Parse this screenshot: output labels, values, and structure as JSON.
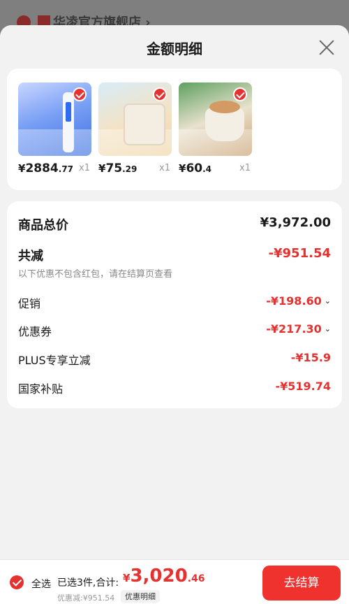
{
  "background": {
    "store_name": "华凌官方旗舰店 ›"
  },
  "sheet": {
    "title": "金额明细"
  },
  "products": [
    {
      "price_cur": "¥",
      "price_int": "2884",
      "price_dec": ".77",
      "qty": "x1"
    },
    {
      "price_cur": "¥",
      "price_int": "75",
      "price_dec": ".29",
      "qty": "x1"
    },
    {
      "price_cur": "¥",
      "price_int": "60",
      "price_dec": ".4",
      "qty": "x1"
    }
  ],
  "summary": {
    "total_label": "商品总价",
    "total_value": "¥3,972.00",
    "reduction_label": "共减",
    "reduction_value": "-¥951.54",
    "note": "以下优惠不包含红包，请在结算页查看",
    "items": [
      {
        "label": "促销",
        "value": "-¥198.60",
        "chevron": "⌄"
      },
      {
        "label": "优惠券",
        "value": "-¥217.30",
        "chevron": "⌄"
      },
      {
        "label": "PLUS专享立减",
        "value": "-¥15.9"
      },
      {
        "label": "国家补贴",
        "value": "-¥519.74"
      }
    ]
  },
  "bottom_bar": {
    "select_all": "全选",
    "selected_text": "已选3件,合计:",
    "total_cur": "¥",
    "total_int": "3,020",
    "total_dec": ".46",
    "saved_text": "优惠减:¥951.54",
    "detail_button": "优惠明细",
    "checkout_button": "去结算"
  },
  "colors": {
    "accent": "#e5312f",
    "checkout": "#f0322f"
  }
}
